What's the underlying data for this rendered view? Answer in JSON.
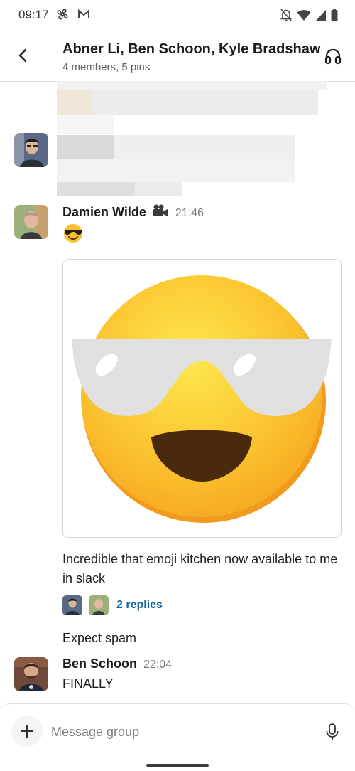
{
  "status_bar": {
    "time": "09:17"
  },
  "header": {
    "title": "Abner Li, Ben Schoon, Kyle Bradshaw",
    "subtitle": "4 members, 5 pins"
  },
  "messages": [
    {
      "author": "Damien Wilde",
      "author_badge_icon": "video-camera-icon",
      "time": "21:46",
      "emoji": "😎",
      "image_alt": "smiling-face-with-sunglasses-emoji",
      "caption": "Incredible that emoji kitchen now available to me in slack",
      "replies_label": "2 replies",
      "followup": "Expect spam"
    },
    {
      "author": "Ben Schoon",
      "time": "22:04",
      "text": "FINALLY"
    }
  ],
  "composer": {
    "placeholder": "Message group"
  },
  "colors": {
    "link": "#1264a3",
    "emoji_yellow": "#fbc02d",
    "glasses": "#e0e0e0"
  }
}
